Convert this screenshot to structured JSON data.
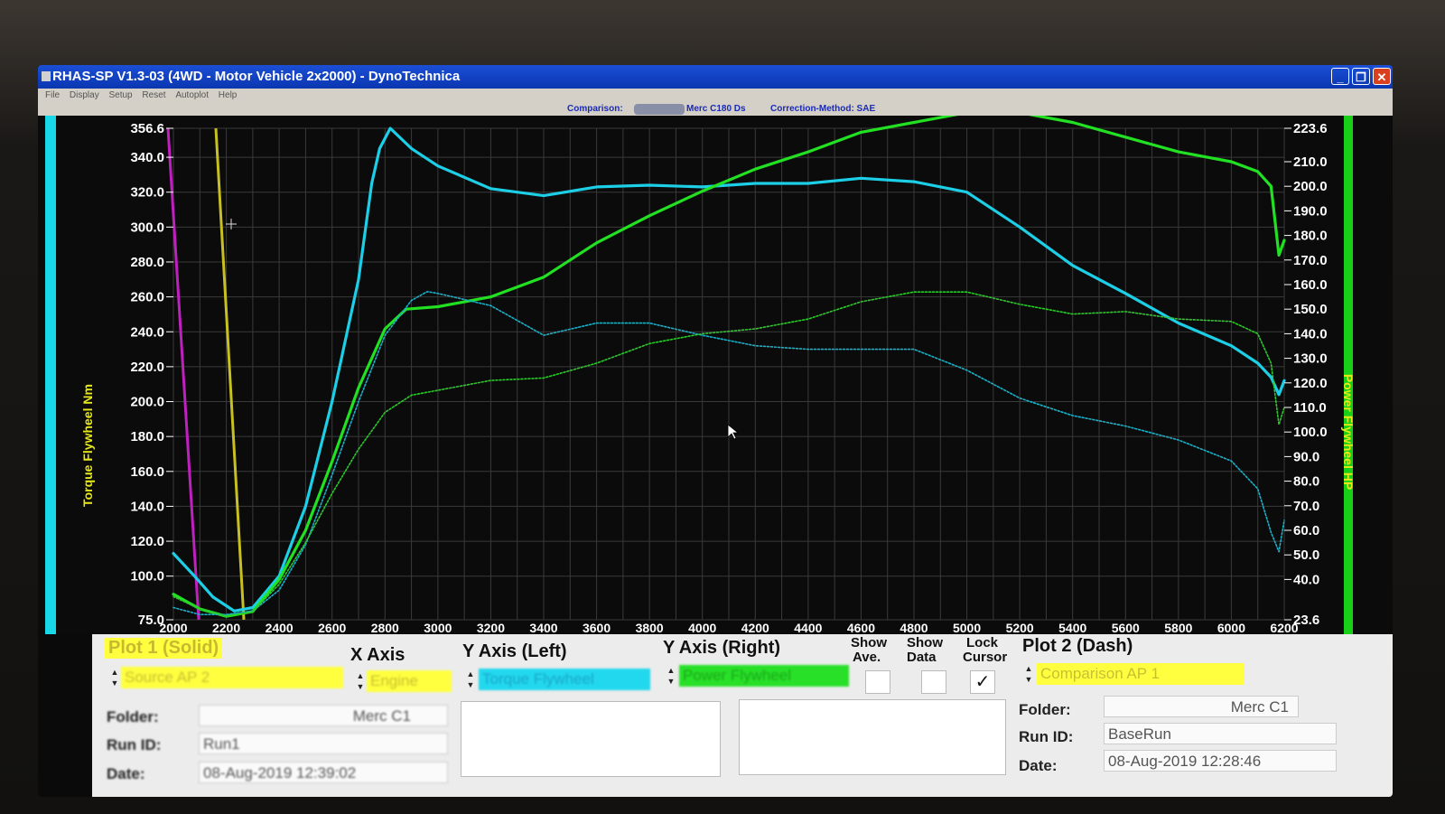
{
  "window": {
    "title": "RHAS-SP V1.3-03  (4WD - Motor Vehicle 2x2000) - DynoTechnica",
    "menu": [
      "File",
      "Display",
      "Setup",
      "Reset",
      "Autoplot",
      "Help"
    ]
  },
  "comparison_bar": {
    "comparison_label": "Comparison:",
    "vehicle": "Merc C180 Ds",
    "correction": "Correction-Method: SAE"
  },
  "chart_data": {
    "type": "line",
    "xlabel": "",
    "ylabel_left": "Torque Flywheel Nm",
    "ylabel_right": "Power Flywheel HP",
    "xlim": [
      2000,
      6200
    ],
    "ylim_left": [
      75.0,
      356.6
    ],
    "ylim_right": [
      23.6,
      223.6
    ],
    "grid": true,
    "x_ticks": [
      "2000",
      "2200",
      "2400",
      "2600",
      "2800",
      "3000",
      "3200",
      "3400",
      "3600",
      "3800",
      "4000",
      "4200",
      "4400",
      "4600",
      "4800",
      "5000",
      "5200",
      "5400",
      "5600",
      "5800",
      "6000",
      "6200"
    ],
    "y_left_ticks": [
      "75.0",
      "100.0",
      "120.0",
      "140.0",
      "160.0",
      "180.0",
      "200.0",
      "220.0",
      "240.0",
      "260.0",
      "280.0",
      "300.0",
      "320.0",
      "340.0",
      "356.6"
    ],
    "y_right_ticks": [
      "23.6",
      "40.0",
      "50.0",
      "60.0",
      "70.0",
      "80.0",
      "90.0",
      "100.0",
      "110.0",
      "120.0",
      "130.0",
      "140.0",
      "150.0",
      "160.0",
      "170.0",
      "180.0",
      "190.0",
      "200.0",
      "210.0",
      "223.6"
    ],
    "series": [
      {
        "axis": "left",
        "style": "solid",
        "color": "#1ccfe6",
        "x": [
          2000,
          2080,
          2150,
          2230,
          2300,
          2400,
          2500,
          2600,
          2700,
          2750,
          2780,
          2820,
          2900,
          3000,
          3200,
          3400,
          3600,
          3800,
          4000,
          4200,
          4400,
          4600,
          4800,
          5000,
          5200,
          5400,
          5600,
          5800,
          6000,
          6100,
          6150,
          6180,
          6200
        ],
        "y": [
          113,
          100,
          88,
          80,
          82,
          100,
          140,
          200,
          270,
          325,
          345,
          356.6,
          345,
          335,
          322,
          318,
          323,
          324,
          323,
          325,
          325,
          328,
          326,
          320,
          300,
          278,
          262,
          245,
          232,
          222,
          214,
          204,
          212
        ]
      },
      {
        "axis": "right",
        "style": "solid",
        "color": "#22e022",
        "x": [
          2000,
          2100,
          2200,
          2300,
          2400,
          2500,
          2600,
          2700,
          2800,
          2880,
          3000,
          3200,
          3400,
          3600,
          3800,
          4000,
          4200,
          4400,
          4600,
          4800,
          5000,
          5200,
          5400,
          5600,
          5800,
          6000,
          6100,
          6150,
          6180,
          6200
        ],
        "y": [
          34,
          28,
          25,
          27,
          40,
          60,
          88,
          118,
          142,
          150,
          151,
          155,
          163,
          177,
          188,
          198,
          207,
          214,
          222,
          226,
          230,
          230,
          226,
          220,
          214,
          210,
          206,
          200,
          172,
          178
        ]
      },
      {
        "axis": "left",
        "style": "dash",
        "color": "#1ab0c8",
        "x": [
          2000,
          2100,
          2200,
          2300,
          2400,
          2500,
          2600,
          2700,
          2800,
          2900,
          2960,
          3000,
          3200,
          3400,
          3600,
          3800,
          4000,
          4200,
          4400,
          4600,
          4800,
          5000,
          5200,
          5400,
          5600,
          5800,
          6000,
          6100,
          6150,
          6180,
          6200
        ],
        "y": [
          82,
          78,
          78,
          80,
          92,
          118,
          158,
          200,
          238,
          258,
          263,
          262,
          255,
          238,
          245,
          245,
          238,
          232,
          230,
          230,
          230,
          218,
          202,
          192,
          186,
          178,
          166,
          150,
          125,
          114,
          132
        ]
      },
      {
        "axis": "right",
        "style": "dash",
        "color": "#2cc82c",
        "x": [
          2000,
          2100,
          2200,
          2300,
          2400,
          2500,
          2600,
          2700,
          2800,
          2900,
          3000,
          3200,
          3400,
          3600,
          3800,
          4000,
          4200,
          4400,
          4600,
          4800,
          5000,
          5200,
          5400,
          5600,
          5800,
          6000,
          6100,
          6150,
          6180,
          6200
        ],
        "y": [
          33,
          28,
          25,
          27,
          38,
          55,
          75,
          93,
          108,
          115,
          117,
          121,
          122,
          128,
          136,
          140,
          142,
          146,
          153,
          157,
          157,
          152,
          148,
          149,
          146,
          145,
          140,
          128,
          103,
          110
        ]
      }
    ]
  },
  "panel": {
    "plot1": {
      "title": "Plot 1 (Solid)",
      "source": "Source AP 2",
      "folder_label": "Folder:",
      "folder_value": "Merc C1",
      "runid_label": "Run ID:",
      "runid_value": "Run1",
      "date_label": "Date:",
      "date_value": "08-Aug-2019  12:39:02"
    },
    "x_axis": {
      "title": "X Axis",
      "value": "Engine"
    },
    "y_left": {
      "title": "Y Axis (Left)",
      "value": "Torque Flywheel"
    },
    "y_right": {
      "title": "Y Axis (Right)",
      "value": "Power Flywheel"
    },
    "show_ave": {
      "label_top": "Show",
      "label_bottom": "Ave.",
      "checked": false
    },
    "show_data": {
      "label_top": "Show",
      "label_bottom": "Data",
      "checked": false
    },
    "lock_cursor": {
      "label_top": "Lock",
      "label_bottom": "Cursor",
      "checked": true,
      "mark": "✓"
    },
    "plot2": {
      "title": "Plot 2 (Dash)",
      "source": "Comparison AP 1",
      "folder_label": "Folder:",
      "folder_value": "Merc C1",
      "runid_label": "Run ID:",
      "runid_value": "BaseRun",
      "date_label": "Date:",
      "date_value": "08-Aug-2019  12:28:46"
    }
  },
  "colors": {
    "plot_bg": "#0b0b0b",
    "grid": "#3a3a3a",
    "torque": "#1ccfe6",
    "power": "#22e022",
    "label_yellow": "#e8e818"
  }
}
